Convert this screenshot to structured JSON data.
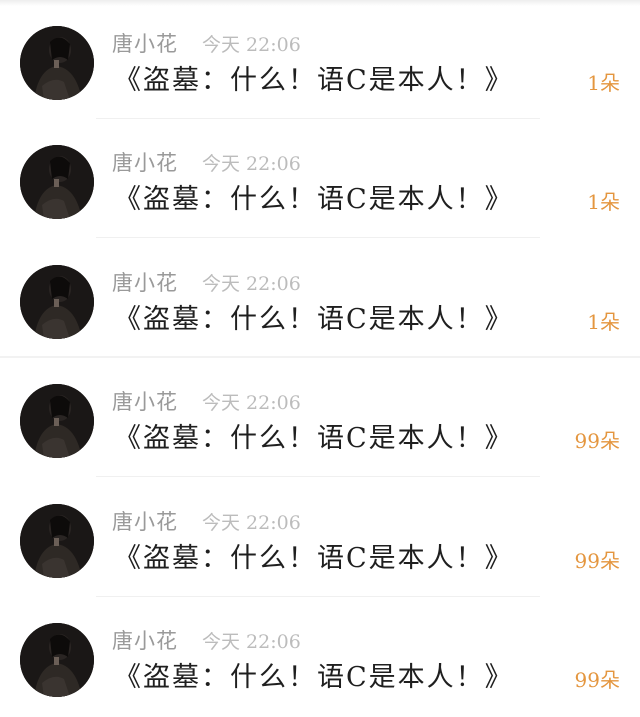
{
  "messages": [
    {
      "username": "唐小花",
      "time": "今天 22:06",
      "text": "《盗墓：什么！语C是本人！》",
      "gift": "1朵"
    },
    {
      "username": "唐小花",
      "time": "今天 22:06",
      "text": "《盗墓：什么！语C是本人！》",
      "gift": "1朵"
    },
    {
      "username": "唐小花",
      "time": "今天 22:06",
      "text": "《盗墓：什么！语C是本人！》",
      "gift": "1朵"
    },
    {
      "username": "唐小花",
      "time": "今天 22:06",
      "text": "《盗墓：什么！语C是本人！》",
      "gift": "99朵"
    },
    {
      "username": "唐小花",
      "time": "今天 22:06",
      "text": "《盗墓：什么！语C是本人！》",
      "gift": "99朵"
    },
    {
      "username": "唐小花",
      "time": "今天 22:06",
      "text": "《盗墓：什么！语C是本人！》",
      "gift": "99朵"
    }
  ],
  "colors": {
    "gift": "#e4963f",
    "username": "#9a9a9a",
    "timestamp": "#bcbcbc",
    "message": "#1f1f1f"
  },
  "icons": {
    "avatar": "user-avatar-photo"
  }
}
